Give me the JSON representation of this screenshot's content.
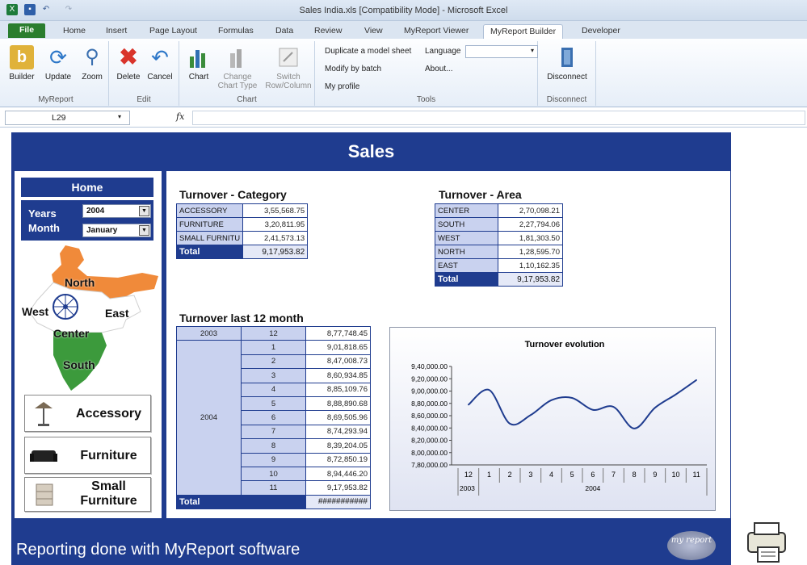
{
  "window": {
    "title": "Sales India.xls  [Compatibility Mode]  -  Microsoft Excel"
  },
  "tabs": [
    "File",
    "Home",
    "Insert",
    "Page Layout",
    "Formulas",
    "Data",
    "Review",
    "View",
    "MyReport Viewer",
    "MyReport Builder",
    "Developer"
  ],
  "ribbon": {
    "myreport": {
      "label": "MyReport",
      "builder": "Builder",
      "update": "Update",
      "zoom": "Zoom"
    },
    "edit": {
      "label": "Edit",
      "delete": "Delete",
      "cancel": "Cancel"
    },
    "chart": {
      "label": "Chart",
      "chart": "Chart",
      "change_l1": "Change",
      "change_l2": "Chart Type",
      "switch_l1": "Switch",
      "switch_l2": "Row/Column"
    },
    "tools": {
      "label": "Tools",
      "duplicate": "Duplicate a model sheet",
      "language": "Language",
      "modify": "Modify by batch",
      "about": "About...",
      "profile": "My profile"
    },
    "disconnect": {
      "label": "Disconnect",
      "button": "Disconnect"
    }
  },
  "formula_bar": {
    "cell": "L29",
    "fx": "fx",
    "value": ""
  },
  "dashboard": {
    "title": "Sales",
    "footer": "Reporting done with MyReport software",
    "logo": "my report",
    "home": "Home",
    "years_label": "Years",
    "month_label": "Month",
    "year_value": "2004",
    "month_value": "January",
    "map_labels": {
      "north": "North",
      "west": "West",
      "east": "East",
      "center": "Center",
      "south": "South"
    },
    "categories": [
      "Accessory",
      "Furniture",
      "Small\nFurniture"
    ],
    "turnover_category": {
      "title": "Turnover - Category",
      "rows": [
        [
          "ACCESSORY",
          "3,55,568.75"
        ],
        [
          "FURNITURE",
          "3,20,811.95"
        ],
        [
          "SMALL FURNITU",
          "2,41,573.13"
        ]
      ],
      "total_label": "Total",
      "total": "9,17,953.82"
    },
    "turnover_area": {
      "title": "Turnover - Area",
      "rows": [
        [
          "CENTER",
          "2,70,098.21"
        ],
        [
          "SOUTH",
          "2,27,794.06"
        ],
        [
          "WEST",
          "1,81,303.50"
        ],
        [
          "NORTH",
          "1,28,595.70"
        ],
        [
          "EAST",
          "1,10,162.35"
        ]
      ],
      "total_label": "Total",
      "total": "9,17,953.82"
    },
    "turnover_12": {
      "title": "Turnover last 12 month",
      "rows": [
        [
          "2003",
          "12",
          "8,77,748.45"
        ],
        [
          "2004",
          "1",
          "9,01,818.65"
        ],
        [
          "",
          "2",
          "8,47,008.73"
        ],
        [
          "",
          "3",
          "8,60,934.85"
        ],
        [
          "",
          "4",
          "8,85,109.76"
        ],
        [
          "",
          "5",
          "8,88,890.68"
        ],
        [
          "",
          "6",
          "8,69,505.96"
        ],
        [
          "",
          "7",
          "8,74,293.94"
        ],
        [
          "",
          "8",
          "8,39,204.05"
        ],
        [
          "",
          "9",
          "8,72,850.19"
        ],
        [
          "",
          "10",
          "8,94,446.20"
        ],
        [
          "",
          "11",
          "9,17,953.82"
        ]
      ],
      "total_label": "Total",
      "total": "###########"
    }
  },
  "chart_data": {
    "type": "line",
    "title": "Turnover evolution",
    "categories": [
      "12",
      "1",
      "2",
      "3",
      "4",
      "5",
      "6",
      "7",
      "8",
      "9",
      "10",
      "11"
    ],
    "groups": [
      {
        "label": "2003",
        "span": 1
      },
      {
        "label": "2004",
        "span": 11
      }
    ],
    "series": [
      {
        "values": [
          877748.45,
          901818.65,
          847008.73,
          860934.85,
          885109.76,
          888890.68,
          869505.96,
          874293.94,
          839204.05,
          872850.19,
          894446.2,
          917953.82
        ]
      }
    ],
    "ylim": [
      780000,
      940000
    ],
    "yticks": [
      "7,80,000.00",
      "8,00,000.00",
      "8,20,000.00",
      "8,40,000.00",
      "8,60,000.00",
      "8,80,000.00",
      "9,00,000.00",
      "9,20,000.00",
      "9,40,000.00"
    ],
    "grid": false,
    "color": "#1f3c8f"
  }
}
